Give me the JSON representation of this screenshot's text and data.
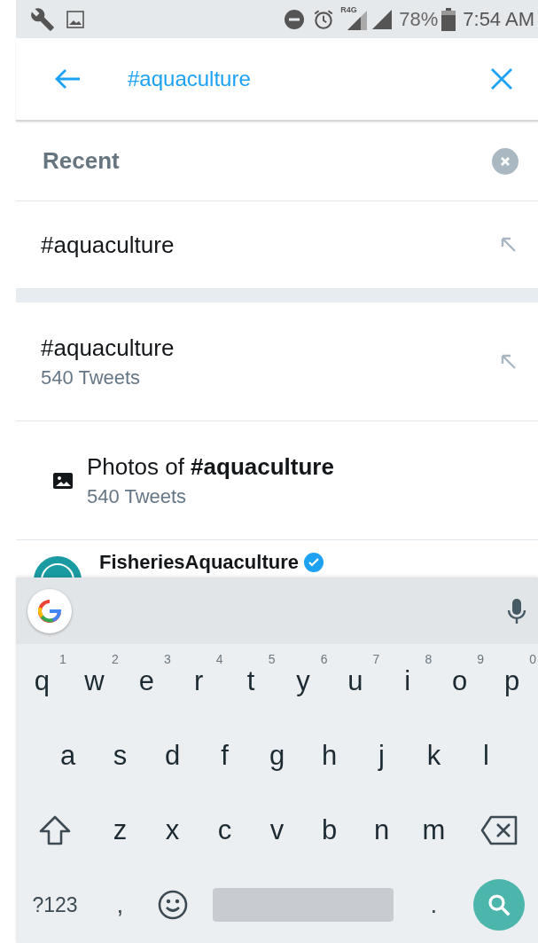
{
  "status_bar": {
    "network": "R4G",
    "battery": "78%",
    "time": "7:54 AM"
  },
  "search": {
    "value": "#aquaculture"
  },
  "recent": {
    "title": "Recent",
    "items": [
      {
        "text": "#aquaculture"
      }
    ]
  },
  "suggestions": [
    {
      "kind": "hashtag",
      "title": "#aquaculture",
      "subtitle": "540 Tweets"
    },
    {
      "kind": "photos",
      "title": "Photos of **#aquaculture**",
      "subtitle": "540 Tweets"
    },
    {
      "kind": "account",
      "title": "FisheriesAquaculture",
      "verified": true
    }
  ],
  "keyboard": {
    "rows": [
      {
        "keys": [
          {
            "kind": "letter",
            "label": "q",
            "hint": "1"
          },
          {
            "kind": "letter",
            "label": "w",
            "hint": "2"
          },
          {
            "kind": "letter",
            "label": "e",
            "hint": "3"
          },
          {
            "kind": "letter",
            "label": "r",
            "hint": "4"
          },
          {
            "kind": "letter",
            "label": "t",
            "hint": "5"
          },
          {
            "kind": "letter",
            "label": "y",
            "hint": "6"
          },
          {
            "kind": "letter",
            "label": "u",
            "hint": "7"
          },
          {
            "kind": "letter",
            "label": "i",
            "hint": "8"
          },
          {
            "kind": "letter",
            "label": "o",
            "hint": "9"
          },
          {
            "kind": "letter",
            "label": "p",
            "hint": "0"
          }
        ]
      },
      {
        "keys": [
          {
            "kind": "letter",
            "label": "a"
          },
          {
            "kind": "letter",
            "label": "s"
          },
          {
            "kind": "letter",
            "label": "d"
          },
          {
            "kind": "letter",
            "label": "f"
          },
          {
            "kind": "letter",
            "label": "g"
          },
          {
            "kind": "letter",
            "label": "h"
          },
          {
            "kind": "letter",
            "label": "j"
          },
          {
            "kind": "letter",
            "label": "k"
          },
          {
            "kind": "letter",
            "label": "l"
          }
        ]
      },
      {
        "keys": [
          {
            "kind": "shift"
          },
          {
            "kind": "letter",
            "label": "z"
          },
          {
            "kind": "letter",
            "label": "x"
          },
          {
            "kind": "letter",
            "label": "c"
          },
          {
            "kind": "letter",
            "label": "v"
          },
          {
            "kind": "letter",
            "label": "b"
          },
          {
            "kind": "letter",
            "label": "n"
          },
          {
            "kind": "letter",
            "label": "m"
          },
          {
            "kind": "backspace"
          }
        ]
      },
      {
        "keys": [
          {
            "kind": "symbols",
            "label": "?123"
          },
          {
            "kind": "text",
            "label": ","
          },
          {
            "kind": "emoji"
          },
          {
            "kind": "space"
          },
          {
            "kind": "text",
            "label": "."
          },
          {
            "kind": "search"
          }
        ]
      }
    ]
  }
}
